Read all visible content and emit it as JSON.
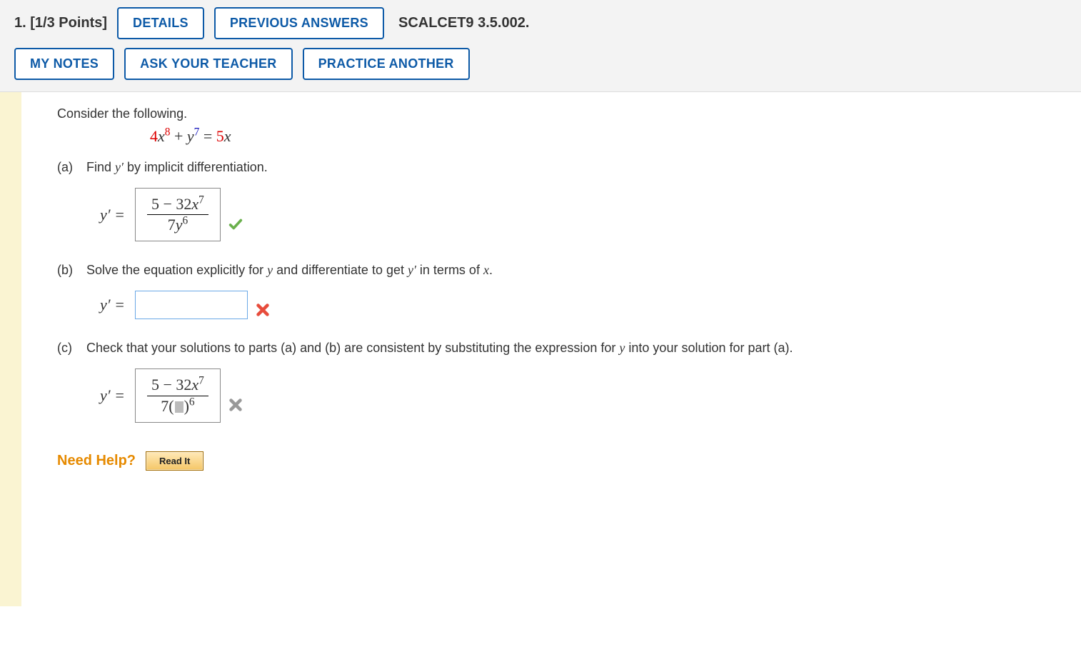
{
  "header": {
    "number_label": "1.",
    "points_label": "[1/3 Points]",
    "details_btn": "DETAILS",
    "prev_answers_btn": "PREVIOUS ANSWERS",
    "source": "SCALCET9 3.5.002.",
    "my_notes_btn": "MY NOTES",
    "ask_teacher_btn": "ASK YOUR TEACHER",
    "practice_btn": "PRACTICE ANOTHER"
  },
  "problem": {
    "intro": "Consider the following.",
    "equation": {
      "coef1": "4",
      "var1": "x",
      "exp1": "8",
      "plus": " + ",
      "var2": "y",
      "exp2": "7",
      "eq": " = ",
      "coef2": "5",
      "var3": "x"
    },
    "parts": {
      "a": {
        "label": "(a)",
        "text_before": "Find ",
        "yprime": "y′",
        "text_after": " by implicit differentiation.",
        "answer_prefix": "y′ =",
        "answer_num_pre": "5 − 32",
        "answer_num_var": "x",
        "answer_num_exp": "7",
        "answer_den_pre": "7",
        "answer_den_var": "y",
        "answer_den_exp": "6",
        "status": "correct"
      },
      "b": {
        "label": "(b)",
        "text1": "Solve the equation explicitly for ",
        "y": "y",
        "text2": " and differentiate to get ",
        "yprime": "y′",
        "text3": " in terms of ",
        "x": "x",
        "text4": ".",
        "answer_prefix": "y′ =",
        "status": "incorrect"
      },
      "c": {
        "label": "(c)",
        "text1": "Check that your solutions to parts (a) and (b) are consistent by substituting the expression for ",
        "y": "y",
        "text2": " into your solution for part (a).",
        "answer_prefix": "y′ =",
        "answer_num_pre": "5 − 32",
        "answer_num_var": "x",
        "answer_num_exp": "7",
        "answer_den_pre": "7(",
        "answer_den_post": ")",
        "answer_den_exp": "6",
        "status": "incorrect"
      }
    }
  },
  "help": {
    "label": "Need Help?",
    "read_btn": "Read It"
  }
}
